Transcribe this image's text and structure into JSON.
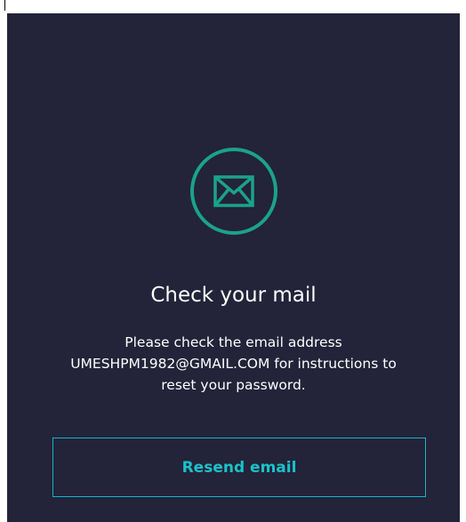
{
  "dialog": {
    "title": "Check your mail",
    "message_line_1": "Please check the email address",
    "message_line_2": "UMESHPM1982@GMAIL.COM for instructions to",
    "message_line_3": "reset your password.",
    "resend_label": "Resend email"
  },
  "icon": {
    "name": "mail-icon"
  },
  "colors": {
    "panel_background": "#23233a",
    "icon_accent": "#1aa38b",
    "button_accent": "#1bc2c8",
    "text": "#ffffff"
  }
}
